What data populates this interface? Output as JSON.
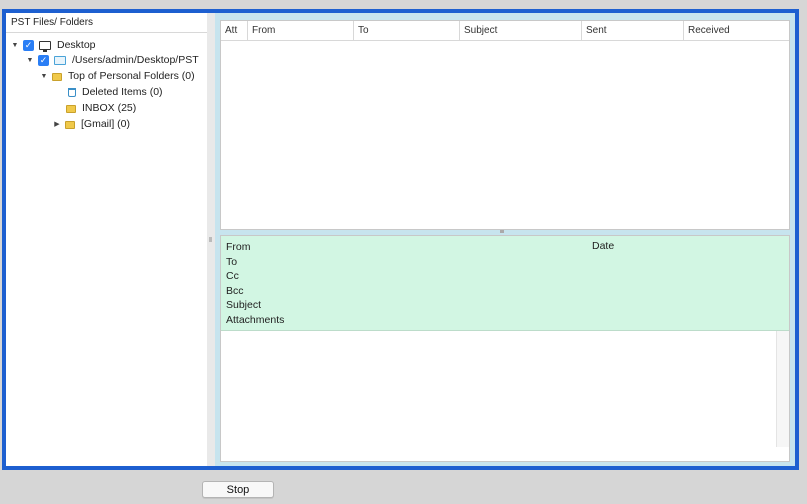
{
  "left_panel": {
    "header": "PST Files/ Folders",
    "tree": [
      {
        "label": "Desktop",
        "icon": "monitor-icon",
        "checked": true,
        "expanded": true
      },
      {
        "label": "/Users/admin/Desktop/PST",
        "icon": "pst-file-icon",
        "checked": true,
        "expanded": true
      },
      {
        "label": "Top of Personal Folders (0)",
        "icon": "folder-icon",
        "expanded": true
      },
      {
        "label": "Deleted Items (0)",
        "icon": "trash-icon"
      },
      {
        "label": "INBOX (25)",
        "icon": "folder-icon"
      },
      {
        "label": "[Gmail] (0)",
        "icon": "folder-icon",
        "expanded": false
      }
    ]
  },
  "mail_list": {
    "columns": [
      "Att",
      "From",
      "To",
      "Subject",
      "Sent",
      "Received"
    ]
  },
  "mail_detail": {
    "from_label": "From",
    "date_label": "Date",
    "to_label": "To",
    "cc_label": "Cc",
    "bcc_label": "Bcc",
    "subject_label": "Subject",
    "attachments_label": "Attachments"
  },
  "footer": {
    "stop_label": "Stop"
  },
  "colors": {
    "frame_border": "#1d5fd0",
    "checkbox": "#2a7ef5",
    "detail_header_bg": "#d2f6e3",
    "pane_bg": "#c7e4ee"
  }
}
